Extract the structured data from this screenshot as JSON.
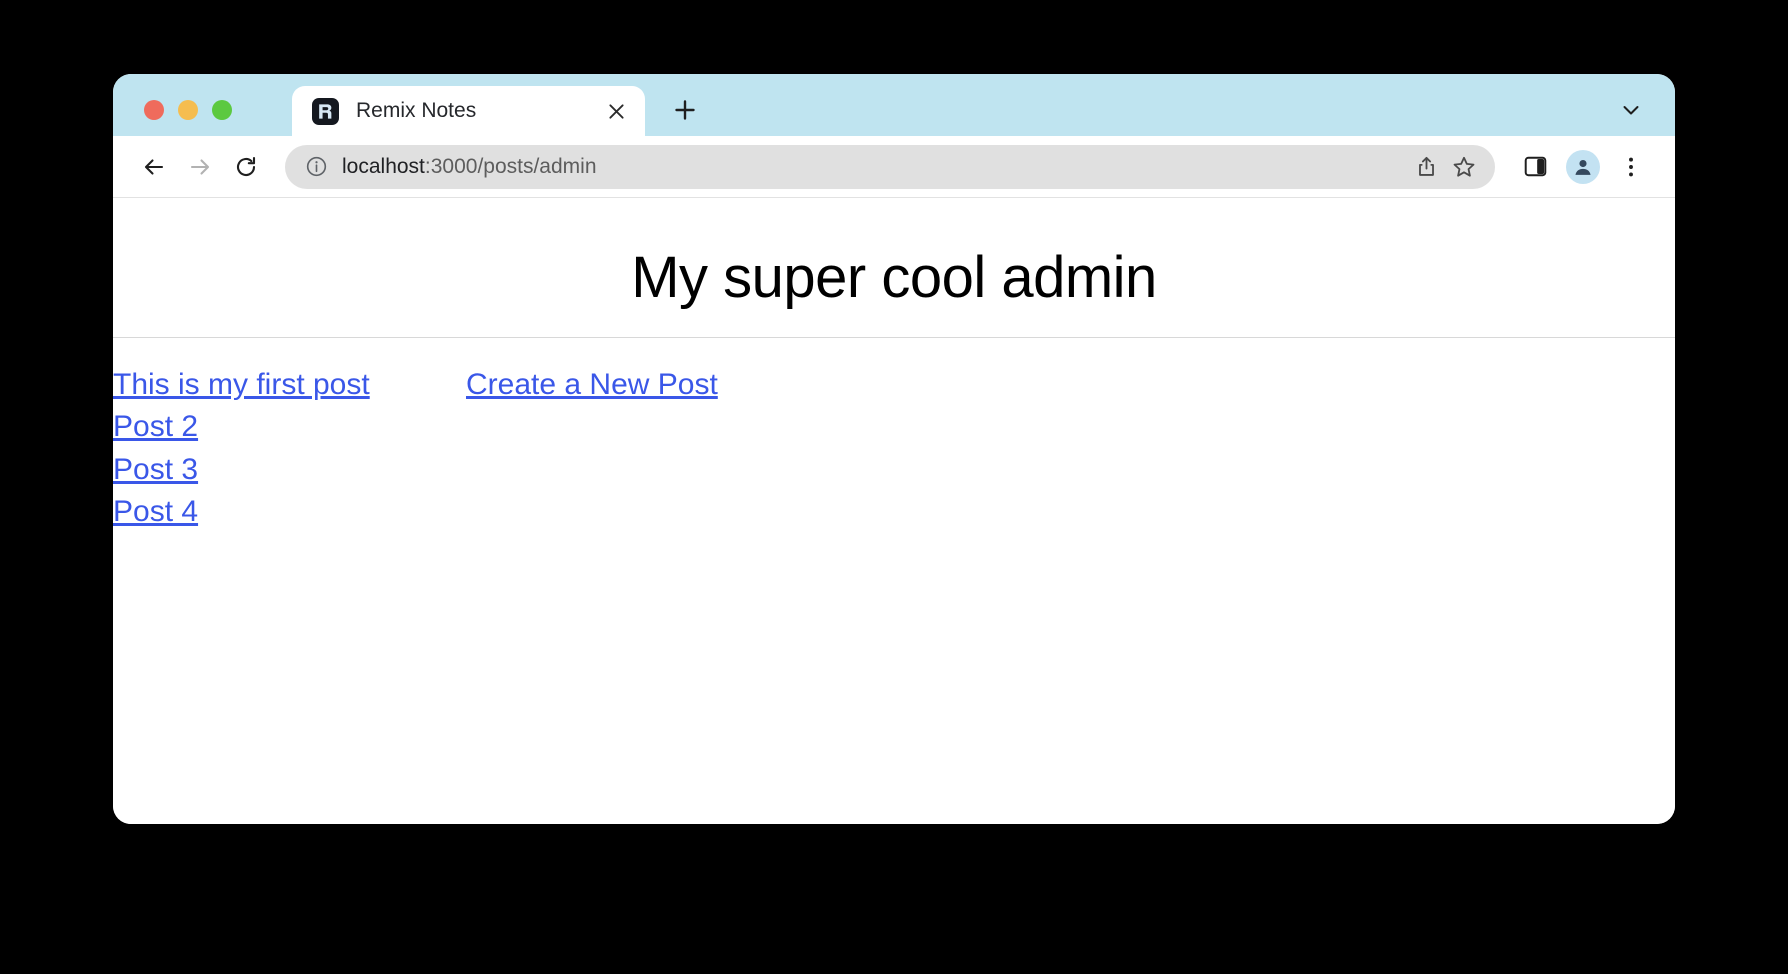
{
  "browser": {
    "traffic_lights": [
      "close",
      "minimize",
      "zoom"
    ],
    "tab": {
      "title": "Remix Notes",
      "favicon": "remix-logo-icon",
      "close_icon": "close-icon"
    },
    "new_tab_icon": "plus-icon",
    "tab_list_chevron_icon": "chevron-down-icon",
    "toolbar": {
      "back_icon": "back-arrow-icon",
      "forward_icon": "forward-arrow-icon",
      "reload_icon": "reload-icon",
      "site_info_icon": "info-circle-icon",
      "url_host": "localhost",
      "url_path": ":3000/posts/admin",
      "url_full": "localhost:3000/posts/admin",
      "share_icon": "share-icon",
      "bookmark_icon": "star-icon",
      "side_panel_icon": "side-panel-icon",
      "profile_icon": "account-avatar-icon",
      "menu_icon": "three-dot-menu-icon"
    },
    "colors": {
      "tabstrip": "#bfe4f0",
      "omnibox": "#e0e0e0",
      "link": "#3a57e8",
      "favicon_bg": "#14181f"
    }
  },
  "page": {
    "heading": "My super cool admin",
    "posts": [
      {
        "label": "This is my first post"
      },
      {
        "label": "Post 2"
      },
      {
        "label": "Post 3"
      },
      {
        "label": "Post 4"
      }
    ],
    "create_link": "Create a New Post"
  }
}
